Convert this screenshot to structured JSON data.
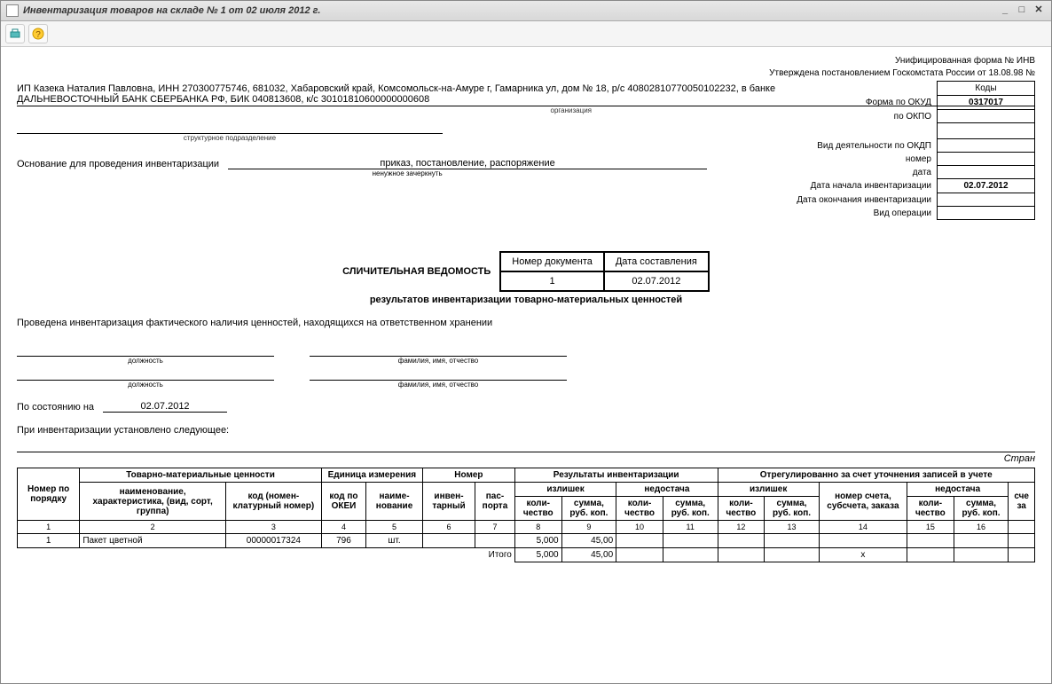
{
  "window": {
    "title": "Инвентаризация товаров на складе № 1 от 02 июля 2012 г."
  },
  "header": {
    "form_label": "Унифицированная форма № ИНВ",
    "approved_label": "Утверждена постановлением Госкомстата России от 18.08.98 №"
  },
  "codes": {
    "header": "Коды",
    "rows": {
      "okud_label": "Форма по ОКУД",
      "okud_value": "0317017",
      "okpo_label": "по ОКПО",
      "okpo_value": "",
      "okdp_label": "Вид деятельности по ОКДП",
      "okdp_value": "",
      "num_label": "номер",
      "num_value": "",
      "date_label": "дата",
      "date_value": "",
      "inv_start_label": "Дата начала инвентаризации",
      "inv_start_value": "02.07.2012",
      "inv_end_label": "Дата окончания инвентаризации",
      "inv_end_value": "",
      "op_label": "Вид операции",
      "op_value": ""
    }
  },
  "org": {
    "line1": "ИП Казека Наталия Павловна, ИНН 270300775746, 681032, Хабаровский край, Комсомольск-на-Амуре г, Гамарника ул, дом № 18, р/с 40802810770050102232, в банке",
    "line2": "ДАЛЬНЕВОСТОЧНЫЙ БАНК СБЕРБАНКА РФ, БИК 040813608, к/с 30101810600000000608",
    "caption": "организация",
    "struct_caption": "структурное подразделение"
  },
  "basis": {
    "label": "Основание для проведения инвентаризации",
    "value": "приказ, постановление, распоряжение",
    "caption": "ненужное зачеркнуть"
  },
  "doc": {
    "num_header": "Номер документа",
    "date_header": "Дата составления",
    "num_value": "1",
    "date_value": "02.07.2012",
    "title": "СЛИЧИТЕЛЬНАЯ ВЕДОМОСТЬ",
    "subtitle": "результатов инвентаризации товарно-материальных ценностей"
  },
  "intro": {
    "text": "Проведена инвентаризация фактического наличия ценностей, находящихся на ответственном хранении"
  },
  "sig": {
    "pos_caption": "должность",
    "fio_caption": "фамилия, имя, отчество"
  },
  "state": {
    "label": "По состоянию на",
    "value": "02.07.2012"
  },
  "established": {
    "text": "При инвентаризации установлено следующее:"
  },
  "page": {
    "label": "Стран"
  },
  "table": {
    "headers": {
      "num": "Номер по порядку",
      "tmc": "Товарно-материальные ценности",
      "unit": "Единица измерения",
      "number": "Номер",
      "inv_results": "Результаты инвентаризации",
      "regulated": "Отрегулированно за счет уточнения записей в учете",
      "name": "наименование, характеристика, (вид, сорт, группа)",
      "code": "код (номен-клатурный номер)",
      "okei": "код по ОКЕИ",
      "unit_name": "наиме-нование",
      "inv_num": "инвен-тарный",
      "passport": "пас-порта",
      "surplus": "излишек",
      "shortage": "недостача",
      "qty": "коли-чество",
      "sum": "сумма, руб. коп.",
      "acct": "номер счета, субсчета, заказа",
      "sch": "сче за"
    },
    "cols": [
      "1",
      "2",
      "3",
      "4",
      "5",
      "6",
      "7",
      "8",
      "9",
      "10",
      "11",
      "12",
      "13",
      "14",
      "15",
      "16",
      ""
    ],
    "rows": [
      {
        "num": "1",
        "name": "Пакет цветной",
        "code": "00000017324",
        "okei": "796",
        "unit_name": "шт.",
        "inv_num": "",
        "passport": "",
        "surplus_qty": "5,000",
        "surplus_sum": "45,00",
        "shortage_qty": "",
        "shortage_sum": "",
        "reg_s_qty": "",
        "reg_s_sum": "",
        "reg_acct": "",
        "reg_sh_qty": "",
        "reg_sh_sum": ""
      }
    ],
    "total": {
      "label": "Итого",
      "surplus_qty": "5,000",
      "surplus_sum": "45,00",
      "x": "х"
    }
  }
}
